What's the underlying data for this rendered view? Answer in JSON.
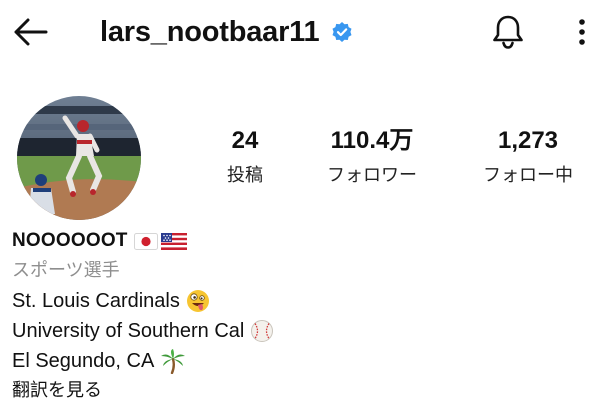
{
  "header": {
    "username": "lars_nootbaar11",
    "back_icon": "arrow-left-icon",
    "verified_icon": "verified-badge-icon",
    "bell_icon": "bell-icon",
    "more_icon": "more-vertical-icon"
  },
  "profile": {
    "avatar_icon": "profile-photo"
  },
  "stats": {
    "posts": {
      "value": "24",
      "label": "投稿"
    },
    "followers": {
      "value": "110.4万",
      "label": "フォロワー"
    },
    "following": {
      "value": "1,273",
      "label": "フォロー中"
    }
  },
  "bio": {
    "display_name": "NOOOOOOT",
    "display_name_emojis": [
      "flag-japan-icon",
      "flag-usa-icon"
    ],
    "category": "スポーツ選手",
    "lines": [
      {
        "text": "St. Louis Cardinals",
        "emoji": "zany-face-icon"
      },
      {
        "text": "University of Southern Cal",
        "emoji": "baseball-icon"
      },
      {
        "text": "El Segundo, CA",
        "emoji": "palm-tree-icon"
      }
    ],
    "translate_label": "翻訳を見る"
  },
  "colors": {
    "verified_blue": "#3897f0",
    "secondary_text": "#8e8e8e",
    "text": "#111111"
  }
}
